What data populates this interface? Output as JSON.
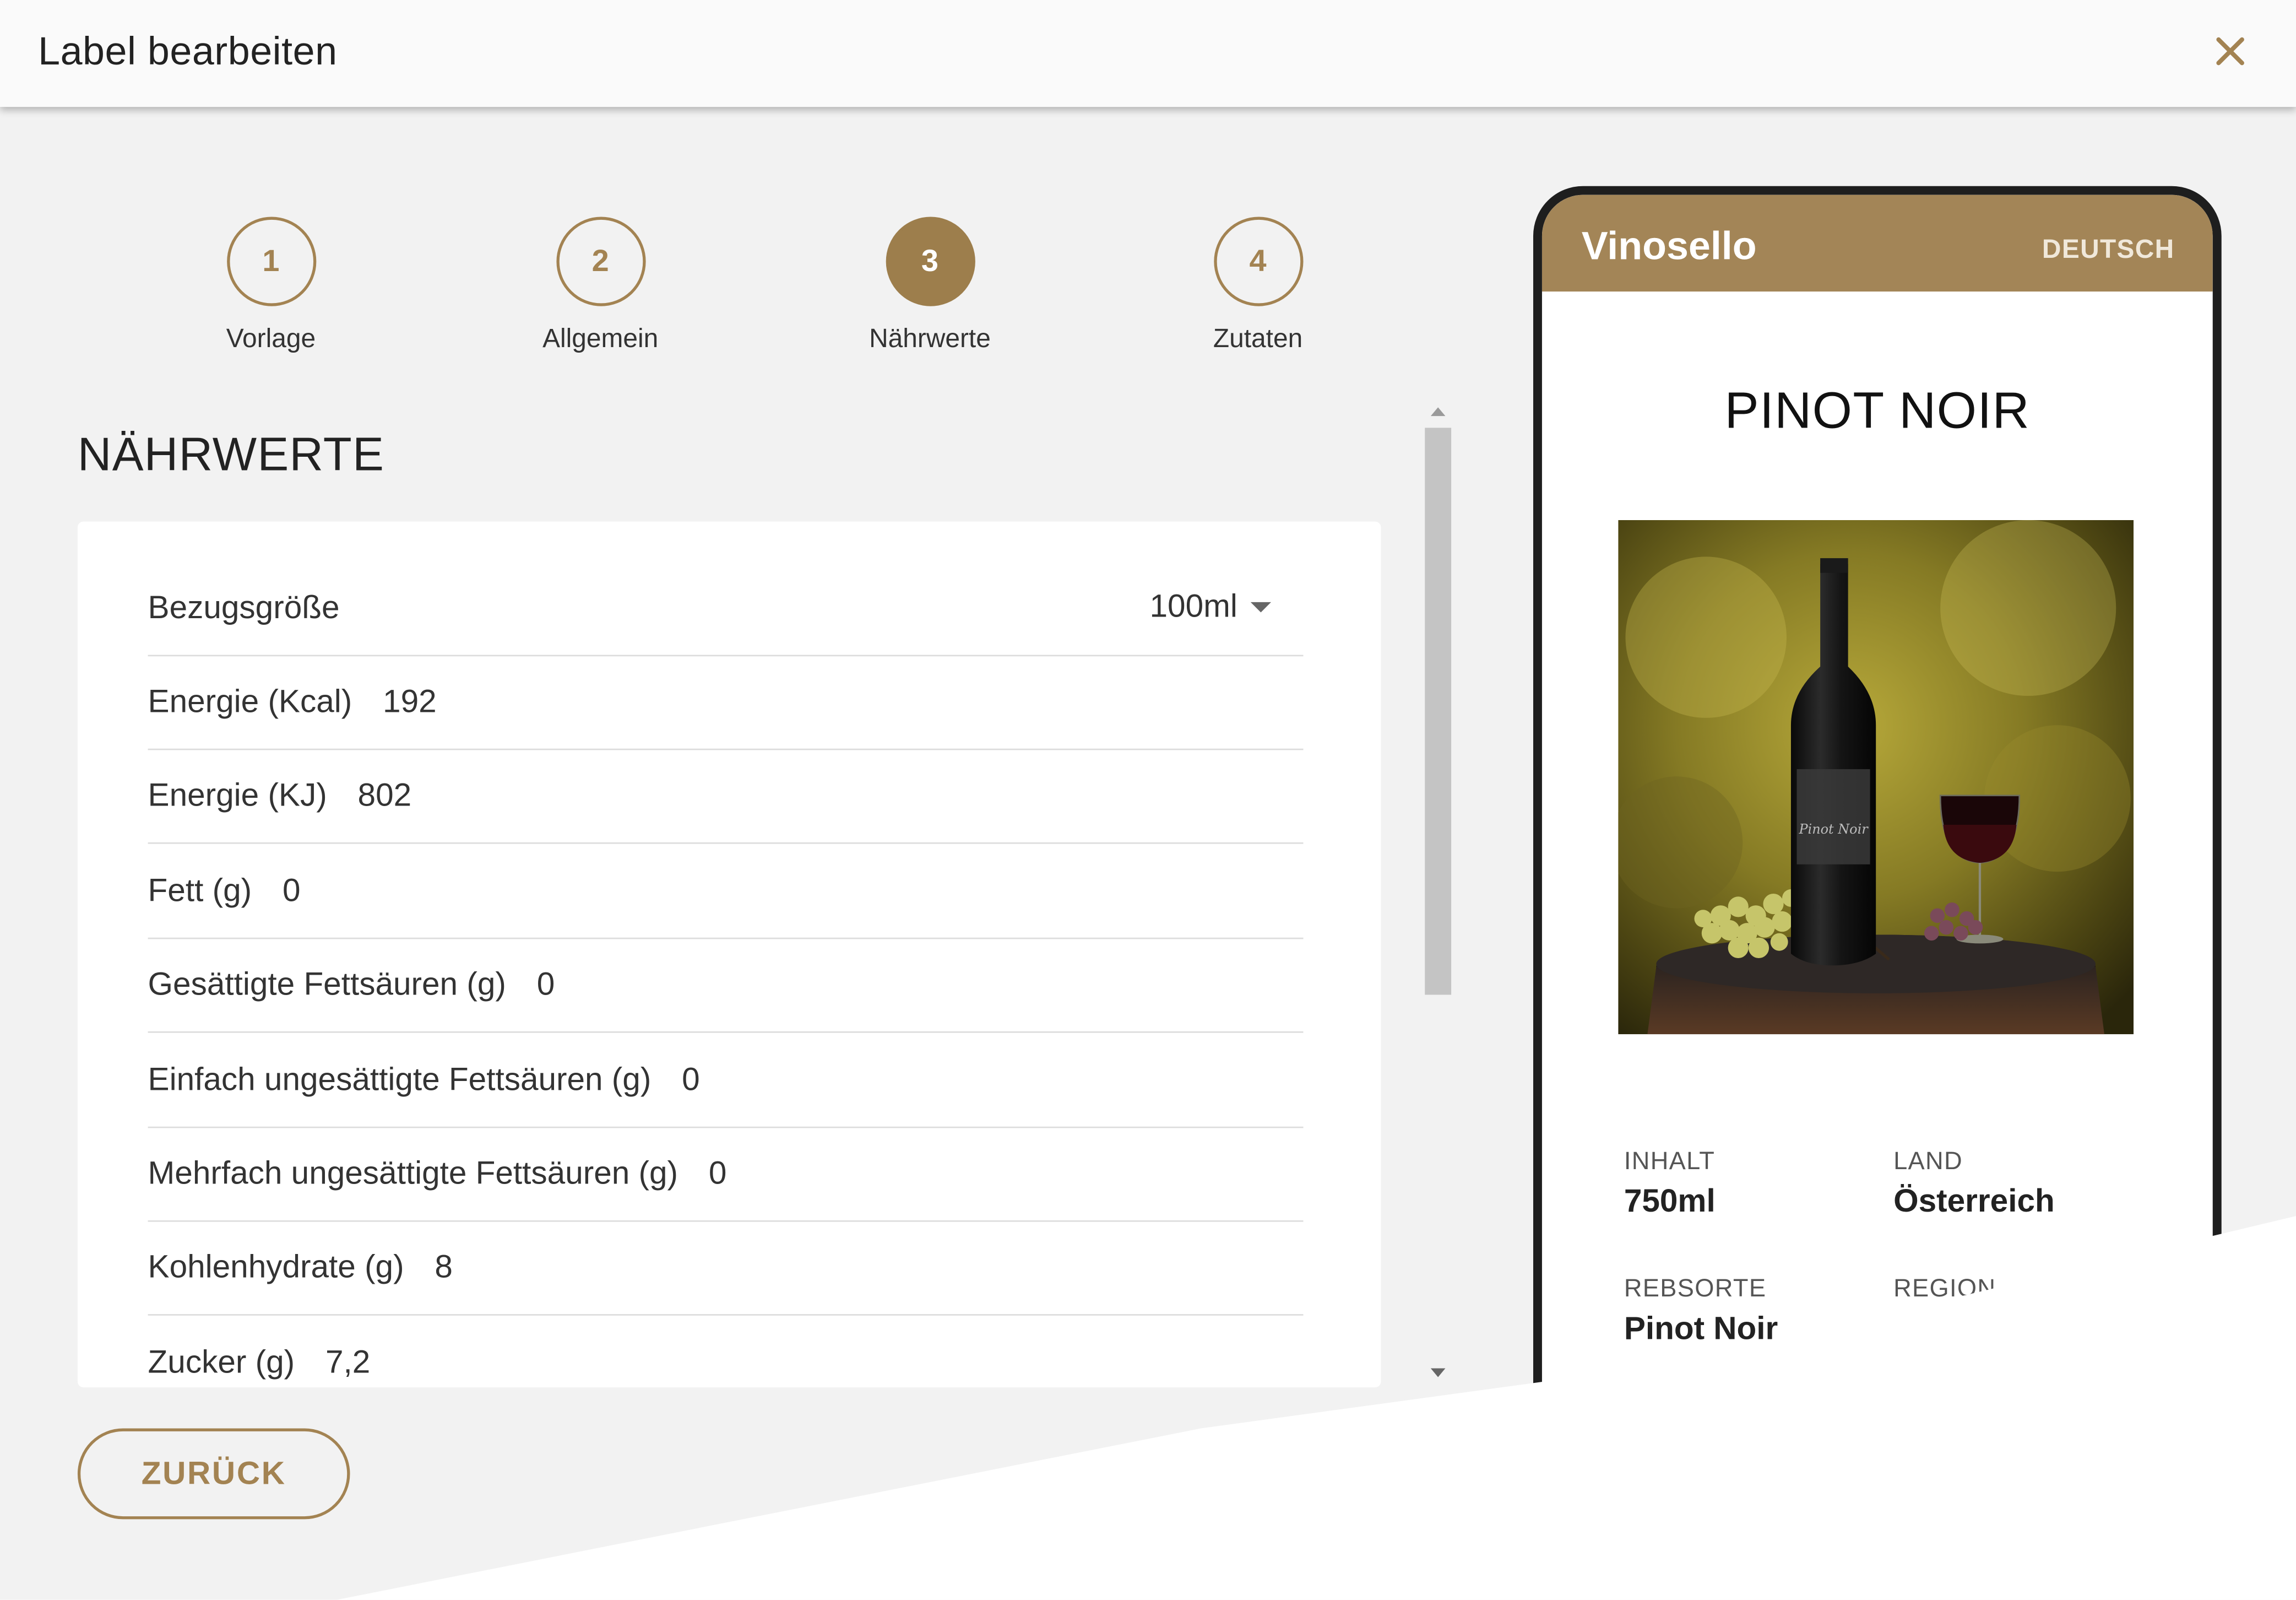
{
  "dialog": {
    "title": "Label bearbeiten",
    "close_icon": "close-icon"
  },
  "stepper": {
    "steps": [
      {
        "number": "1",
        "label": "Vorlage",
        "active": false
      },
      {
        "number": "2",
        "label": "Allgemein",
        "active": false
      },
      {
        "number": "3",
        "label": "Nährwerte",
        "active": true
      },
      {
        "number": "4",
        "label": "Zutaten",
        "active": false
      }
    ]
  },
  "section": {
    "title": "NÄHRWERTE"
  },
  "nutrition": {
    "reference": {
      "label": "Bezugsgröße",
      "value": "100ml"
    },
    "rows": [
      {
        "label": "Energie (Kcal)",
        "value": "192"
      },
      {
        "label": "Energie (KJ)",
        "value": "802"
      },
      {
        "label": "Fett (g)",
        "value": "0"
      },
      {
        "label": "Gesättigte Fettsäuren (g)",
        "value": "0"
      },
      {
        "label": "Einfach ungesättigte Fettsäuren (g)",
        "value": "0"
      },
      {
        "label": "Mehrfach ungesättigte Fettsäuren (g)",
        "value": "0"
      },
      {
        "label": "Kohlenhydrate (g)",
        "value": "8"
      },
      {
        "label": "Zucker (g)",
        "value": "7,2"
      }
    ]
  },
  "footer": {
    "back_label": "ZURÜCK"
  },
  "preview": {
    "brand": "Vinosello",
    "language": "DEUTSCH",
    "wine_name": "PINOT NOIR",
    "bottle_label_text": "Pinot Noir",
    "info": {
      "inhalt_label": "INHALT",
      "inhalt_value": "750ml",
      "land_label": "LAND",
      "land_value": "Österreich",
      "rebsorte_label": "REBSORTE",
      "rebsorte_value": "Pinot Noir",
      "region_label": "REGION"
    }
  },
  "colors": {
    "accent": "#a38352",
    "header_brown": "#a38557",
    "background": "#f2f2f2",
    "card": "#ffffff"
  }
}
